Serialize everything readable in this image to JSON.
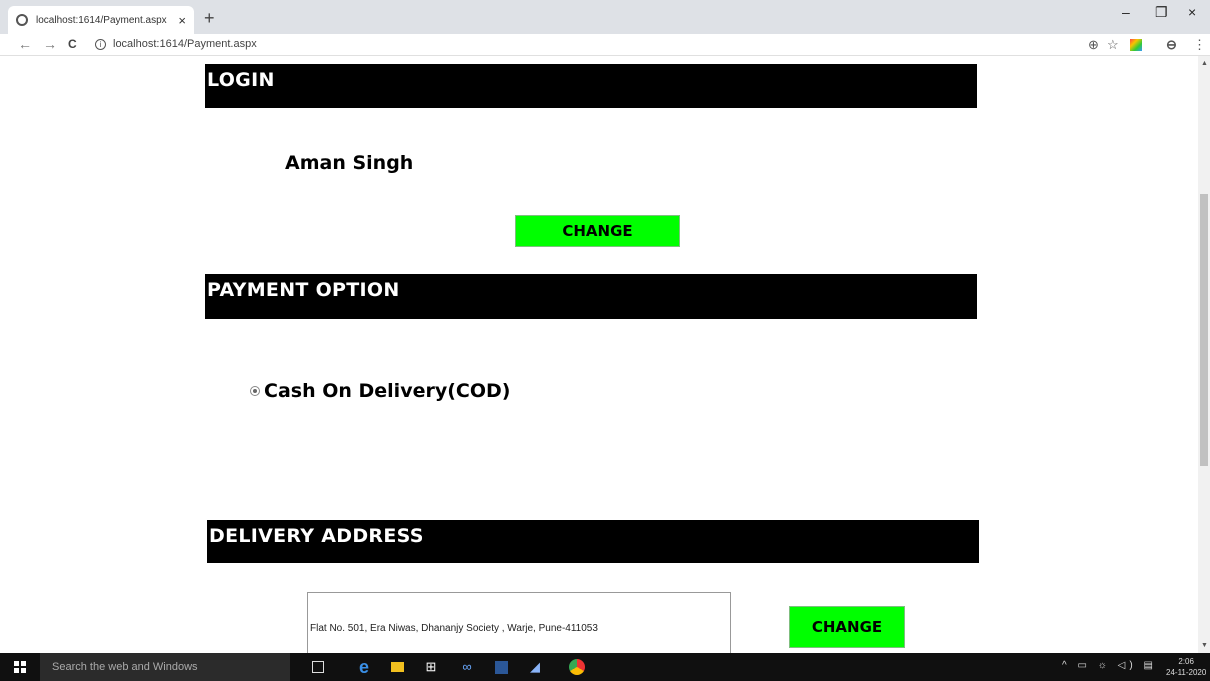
{
  "browser": {
    "tab_title": "localhost:1614/Payment.aspx",
    "tab_close": "×",
    "new_tab": "+",
    "minimize": "–",
    "maximize": "❐",
    "close": "×",
    "back": "←",
    "forward": "→",
    "reload": "C",
    "info": "i",
    "url": "localhost:1614/Payment.aspx",
    "zoom_icon": "⊕",
    "star_icon": "☆",
    "profile_icon": "⊖",
    "menu_icon": "⋮"
  },
  "login": {
    "heading": "LOGIN",
    "user_name": "Aman Singh",
    "change_label": "CHANGE"
  },
  "payment": {
    "heading": "PAYMENT OPTION",
    "option_label": "Cash On Delivery(COD)"
  },
  "delivery": {
    "heading": "DELIVERY ADDRESS",
    "address": "Flat No. 501, Era Niwas, Dhananjy Society , Warje, Pune-411053",
    "change_label": "CHANGE"
  },
  "taskbar": {
    "search_placeholder": "Search the web and Windows",
    "time": "2:06",
    "date": "24-11-2020",
    "tray_icons": "^ ▭ ☼ ◁) ▤"
  },
  "colors": {
    "section_bar": "#000000",
    "change_button": "#00ff00",
    "taskbar": "#101010"
  }
}
